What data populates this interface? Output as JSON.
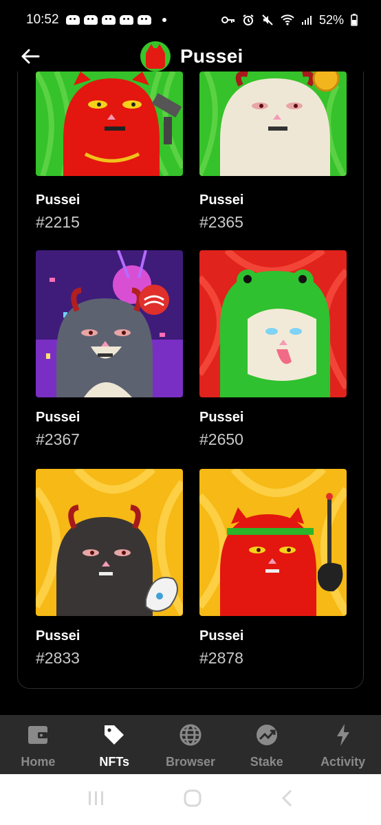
{
  "status_bar": {
    "time": "10:52",
    "battery": "52%"
  },
  "header": {
    "title": "Pussei"
  },
  "nfts": [
    {
      "name": "Pussei",
      "id": "#2215",
      "bg": "#35c22a",
      "cat": "#e3170f",
      "style": "red-gun"
    },
    {
      "name": "Pussei",
      "id": "#2365",
      "bg": "#35c22a",
      "cat": "#efe7d6",
      "style": "white-horns"
    },
    {
      "name": "Pussei",
      "id": "#2367",
      "bg": "#5a2a9e",
      "cat": "#5d6271",
      "style": "gray-horns"
    },
    {
      "name": "Pussei",
      "id": "#2650",
      "bg": "#e0231c",
      "cat": "#f2ead8",
      "style": "frog-hood"
    },
    {
      "name": "Pussei",
      "id": "#2833",
      "bg": "#f6b915",
      "cat": "#3a3535",
      "style": "black-horns"
    },
    {
      "name": "Pussei",
      "id": "#2878",
      "bg": "#f6b915",
      "cat": "#e3170f",
      "style": "red-band"
    }
  ],
  "bottom_nav": {
    "items": [
      {
        "label": "Home",
        "icon": "wallet-icon",
        "active": false
      },
      {
        "label": "NFTs",
        "icon": "tag-icon",
        "active": true
      },
      {
        "label": "Browser",
        "icon": "globe-icon",
        "active": false
      },
      {
        "label": "Stake",
        "icon": "stake-chart-icon",
        "active": false
      },
      {
        "label": "Activity",
        "icon": "lightning-icon",
        "active": false
      }
    ]
  },
  "colors": {
    "background": "#000000",
    "nav_background": "#2b2b2b",
    "inactive_label": "#8a8a8a"
  }
}
